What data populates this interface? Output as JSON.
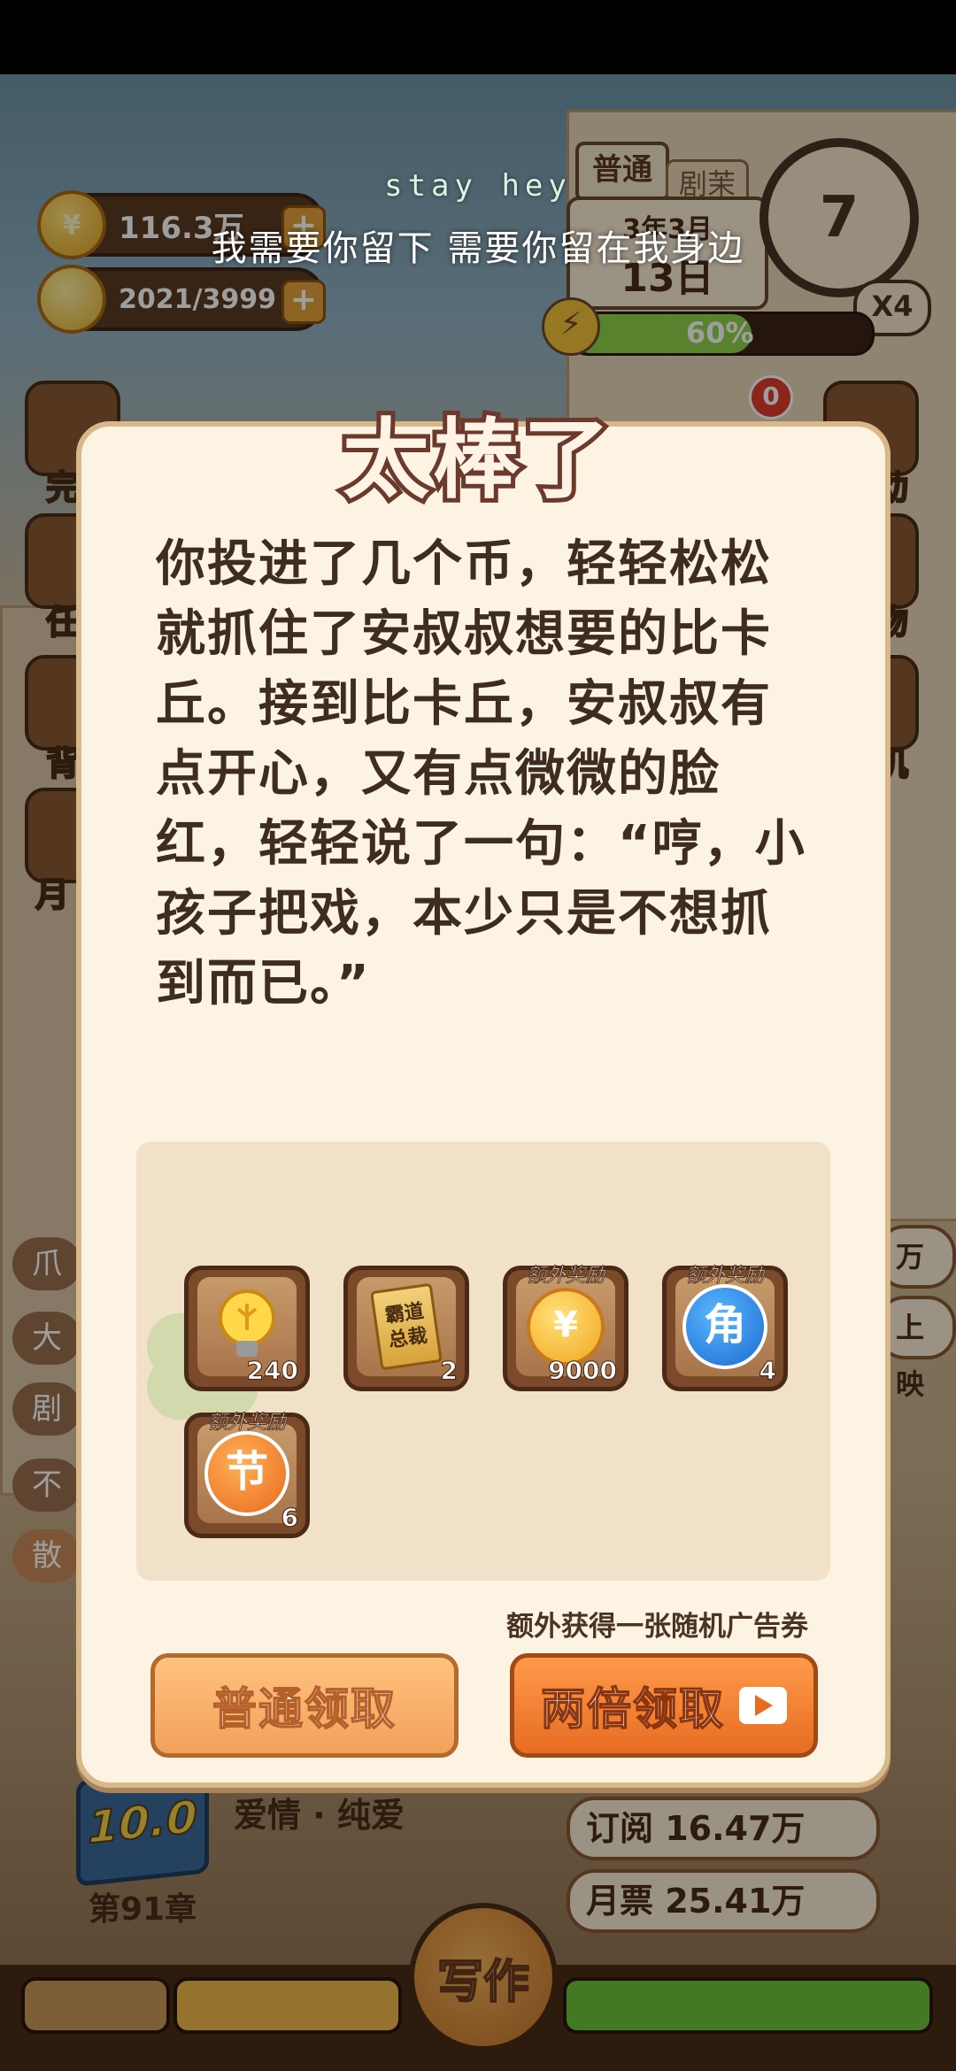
{
  "hud": {
    "coins": "116.3万",
    "energy": "2021/3999",
    "mode": "普通",
    "rank_tag": "剧茉",
    "date": "3年3月",
    "day": "13日",
    "countdown": "7",
    "multiplier": "X4",
    "progress": "60%",
    "badge_count": "0"
  },
  "lyrics": {
    "english": "stay hey",
    "chinese": "我需要你留下 需要你留在我身边"
  },
  "side_left": [
    "完",
    "任",
    "背",
    "月"
  ],
  "side_right": [
    "动",
    "物",
    "机"
  ],
  "tags_left": [
    "爪",
    "大",
    "剧",
    "不",
    "散"
  ],
  "tags_right": [
    "万册",
    "上映"
  ],
  "book": {
    "score": "10.0",
    "genre": "爱情 · 纯爱",
    "chapter": "第91章",
    "subscriptions": "订阅 16.47万",
    "monthly_tickets": "月票 25.41万",
    "write_button": "写作"
  },
  "dialog": {
    "title": "太棒了",
    "story": "你投进了几个币，轻轻松松就抓住了安叔叔想要的比卡丘。接到比卡丘，安叔叔有点开心，又有点微微的脸红，轻轻说了一句：“哼，小孩子把戏，本少只是不想抓到而已。”",
    "rewards": [
      {
        "icon": "lightbulb-icon",
        "count": "240",
        "bonus": ""
      },
      {
        "icon": "book-icon",
        "label": "霸道总裁",
        "count": "2",
        "bonus": ""
      },
      {
        "icon": "coin-icon",
        "count": "9000",
        "bonus": "额外奖励"
      },
      {
        "icon": "jiao-icon",
        "label": "角",
        "count": "4",
        "bonus": "额外奖励"
      },
      {
        "icon": "jie-icon",
        "label": "节",
        "count": "6",
        "bonus": "额外奖励"
      }
    ],
    "extra_note": "额外获得一张随机广告券",
    "normal_claim": "普通领取",
    "double_claim": "两倍领取"
  }
}
